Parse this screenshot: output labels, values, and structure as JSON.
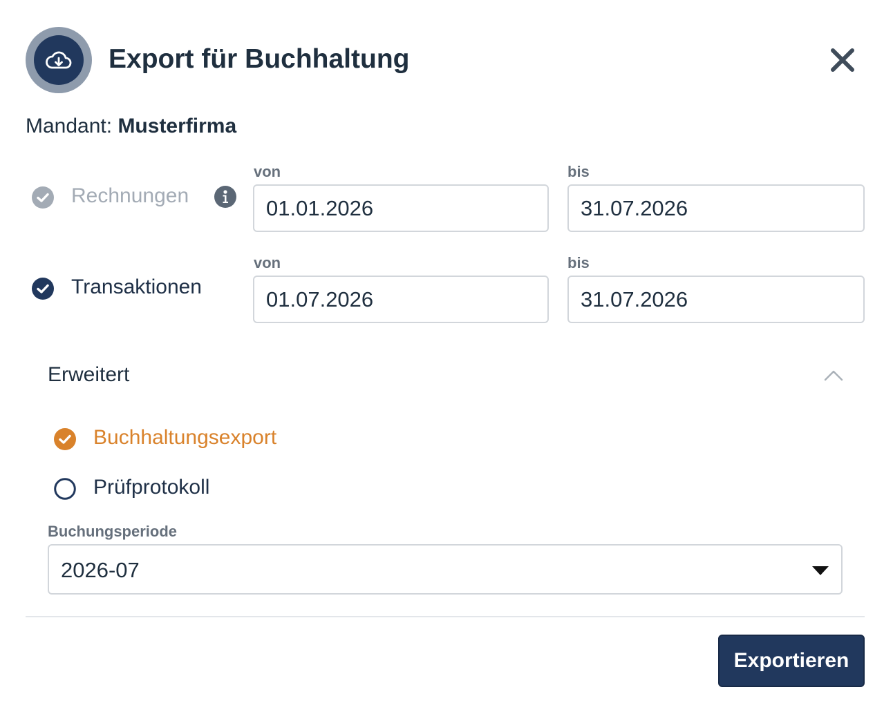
{
  "dialog": {
    "title": "Export für Buchhaltung",
    "header_icon": "cloud-download-icon",
    "close_icon": "close-icon"
  },
  "mandant": {
    "label": "Mandant:",
    "value": "Musterfirma"
  },
  "rows": {
    "rechnungen": {
      "label": "Rechnungen",
      "checked": true,
      "disabled": true,
      "info_icon": "info-icon",
      "from_label": "von",
      "from_value": "01.01.2026",
      "to_label": "bis",
      "to_value": "31.07.2026"
    },
    "transaktionen": {
      "label": "Transaktionen",
      "checked": true,
      "disabled": false,
      "from_label": "von",
      "from_value": "01.07.2026",
      "to_label": "bis",
      "to_value": "31.07.2026"
    }
  },
  "advanced": {
    "label": "Erweitert",
    "expanded": true,
    "options": {
      "buchhaltungsexport": {
        "label": "Buchhaltungsexport",
        "selected": true
      },
      "pruefprotokoll": {
        "label": "Prüfprotokoll",
        "selected": false
      }
    },
    "period": {
      "label": "Buchungsperiode",
      "value": "2026-07"
    }
  },
  "footer": {
    "export_label": "Exportieren"
  },
  "colors": {
    "primary": "#21385d",
    "accent_orange": "#d9822b",
    "muted": "#a3abb5",
    "text": "#1f2f3f",
    "label_gray": "#66707c"
  }
}
